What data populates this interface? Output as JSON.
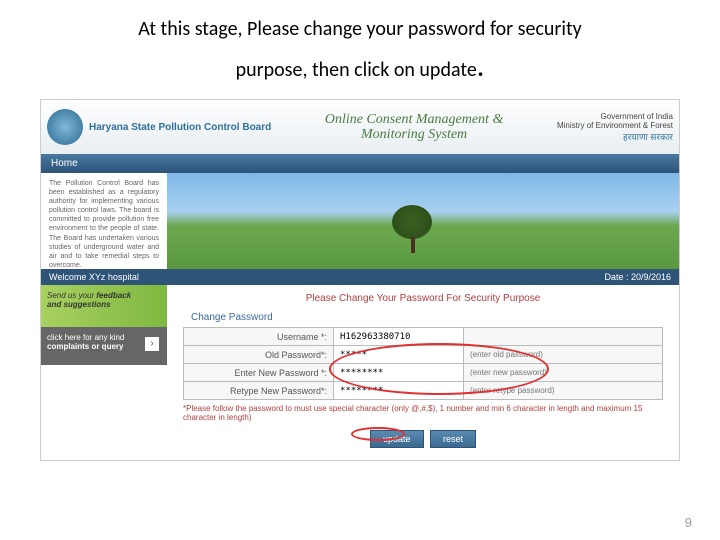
{
  "slide": {
    "title_line1": "At this stage, Please change your password for security",
    "title_line2": "purpose, then click on update",
    "dot": ".",
    "page_number": "9"
  },
  "header": {
    "board_name": "Haryana State Pollution Control Board",
    "center_line1": "Online Consent Management &",
    "center_line2": "Monitoring System",
    "govt": "Government of India",
    "ministry": "Ministry of Environment & Forest",
    "hindi": "हरयाणा सरकार"
  },
  "nav": {
    "home": "Home"
  },
  "sidebar": {
    "about": "The Pollution Control Board has been established as a regulatory authority for implementing various pollution control laws. The board is committed to provide pollution free environment to the people of state. The Board has undertaken various studies of underground water and air and to take remedial steps to overcome."
  },
  "welcome": {
    "text": "Welcome XYz hospital",
    "date": "Date : 20/9/2016"
  },
  "widgets": {
    "feedback_line1": "Send us your",
    "feedback_line2": "feedback",
    "feedback_line3": "and suggestions",
    "complaints_line1": "click here for any kind",
    "complaints_line2": "complaints or query",
    "arrow": "›"
  },
  "form": {
    "title": "Please Change Your Password For Security Purpose",
    "section": "Change Password",
    "labels": {
      "username": "Username *:",
      "old": "Old Password*:",
      "new": "Enter New Password *:",
      "retype": "Retype New Password*:"
    },
    "values": {
      "username": "H162963380710",
      "old": "*****",
      "new": "********",
      "retype": "********"
    },
    "hints": {
      "old": "(enter old password)",
      "new": "(enter new password)",
      "retype": "(enter retype password)"
    },
    "note": "*Please follow the password to must use special character (only @,#,$), 1 number and min 6 character in length and maximum 15 character in length)",
    "buttons": {
      "update": "update",
      "reset": "reset"
    }
  }
}
